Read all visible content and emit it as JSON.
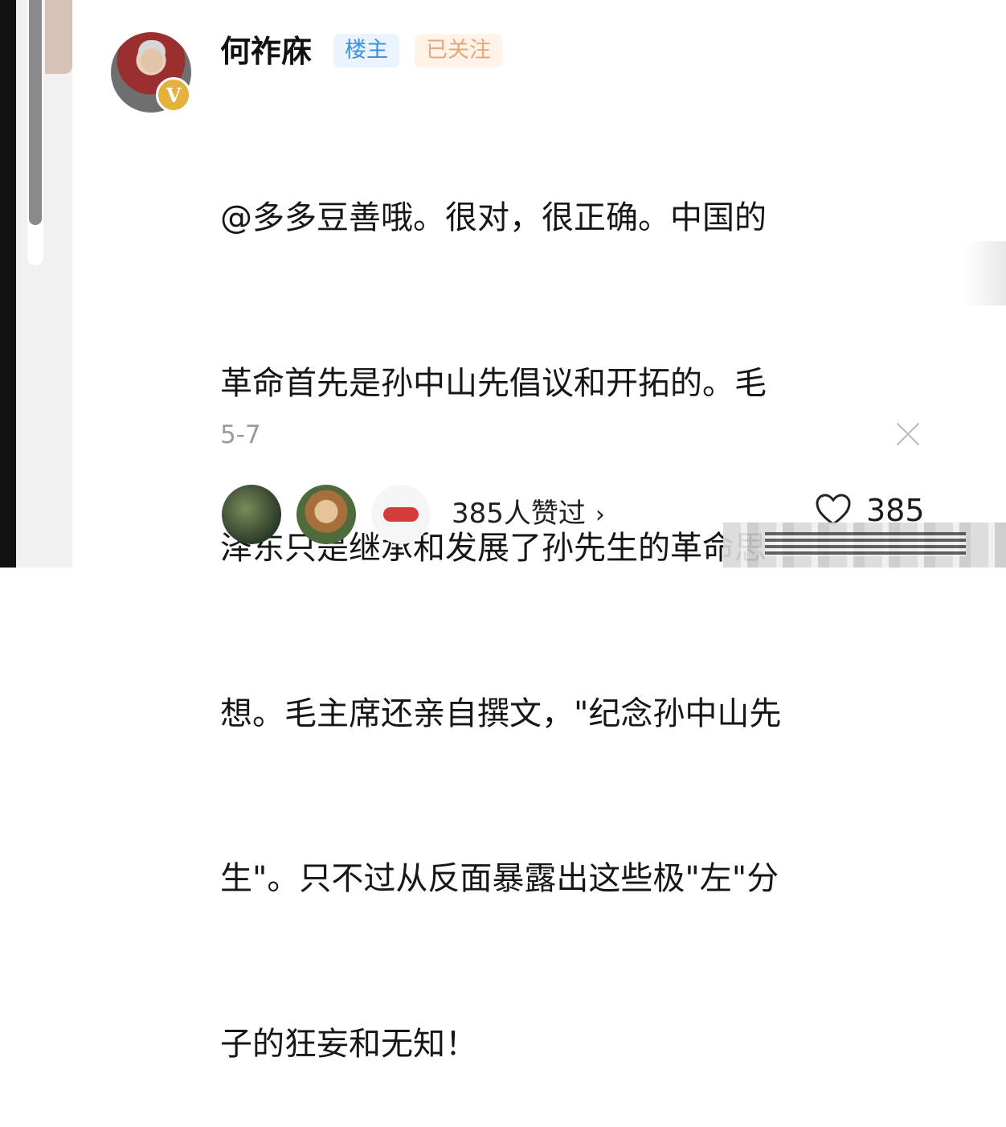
{
  "comment": {
    "username": "何祚庥",
    "owner_badge": "楼主",
    "follow_badge": "已关注",
    "verified_badge_symbol": "V",
    "lines": [
      "@多多豆善哦。很对，很正确。中国的",
      "革命首先是孙中山先倡议和开拓的。毛",
      "泽东只是继承和发展了孙先生的革命思",
      "想。毛主席还亲自撰文，\"纪念孙中山先",
      "生\"。只不过从反面暴露出这些极\"左\"分",
      "子的狂妄和无知！"
    ],
    "date": "5-7"
  },
  "likes": {
    "summary": "385人赞过",
    "chevron": "›",
    "count": "385",
    "icons": [
      "heart-icon",
      "close-icon",
      "chevron-right-icon"
    ]
  },
  "colors": {
    "owner_badge_text": "#3d8fe0",
    "follow_badge_text": "#e3a87d",
    "verified_badge": "#e2b23d"
  }
}
